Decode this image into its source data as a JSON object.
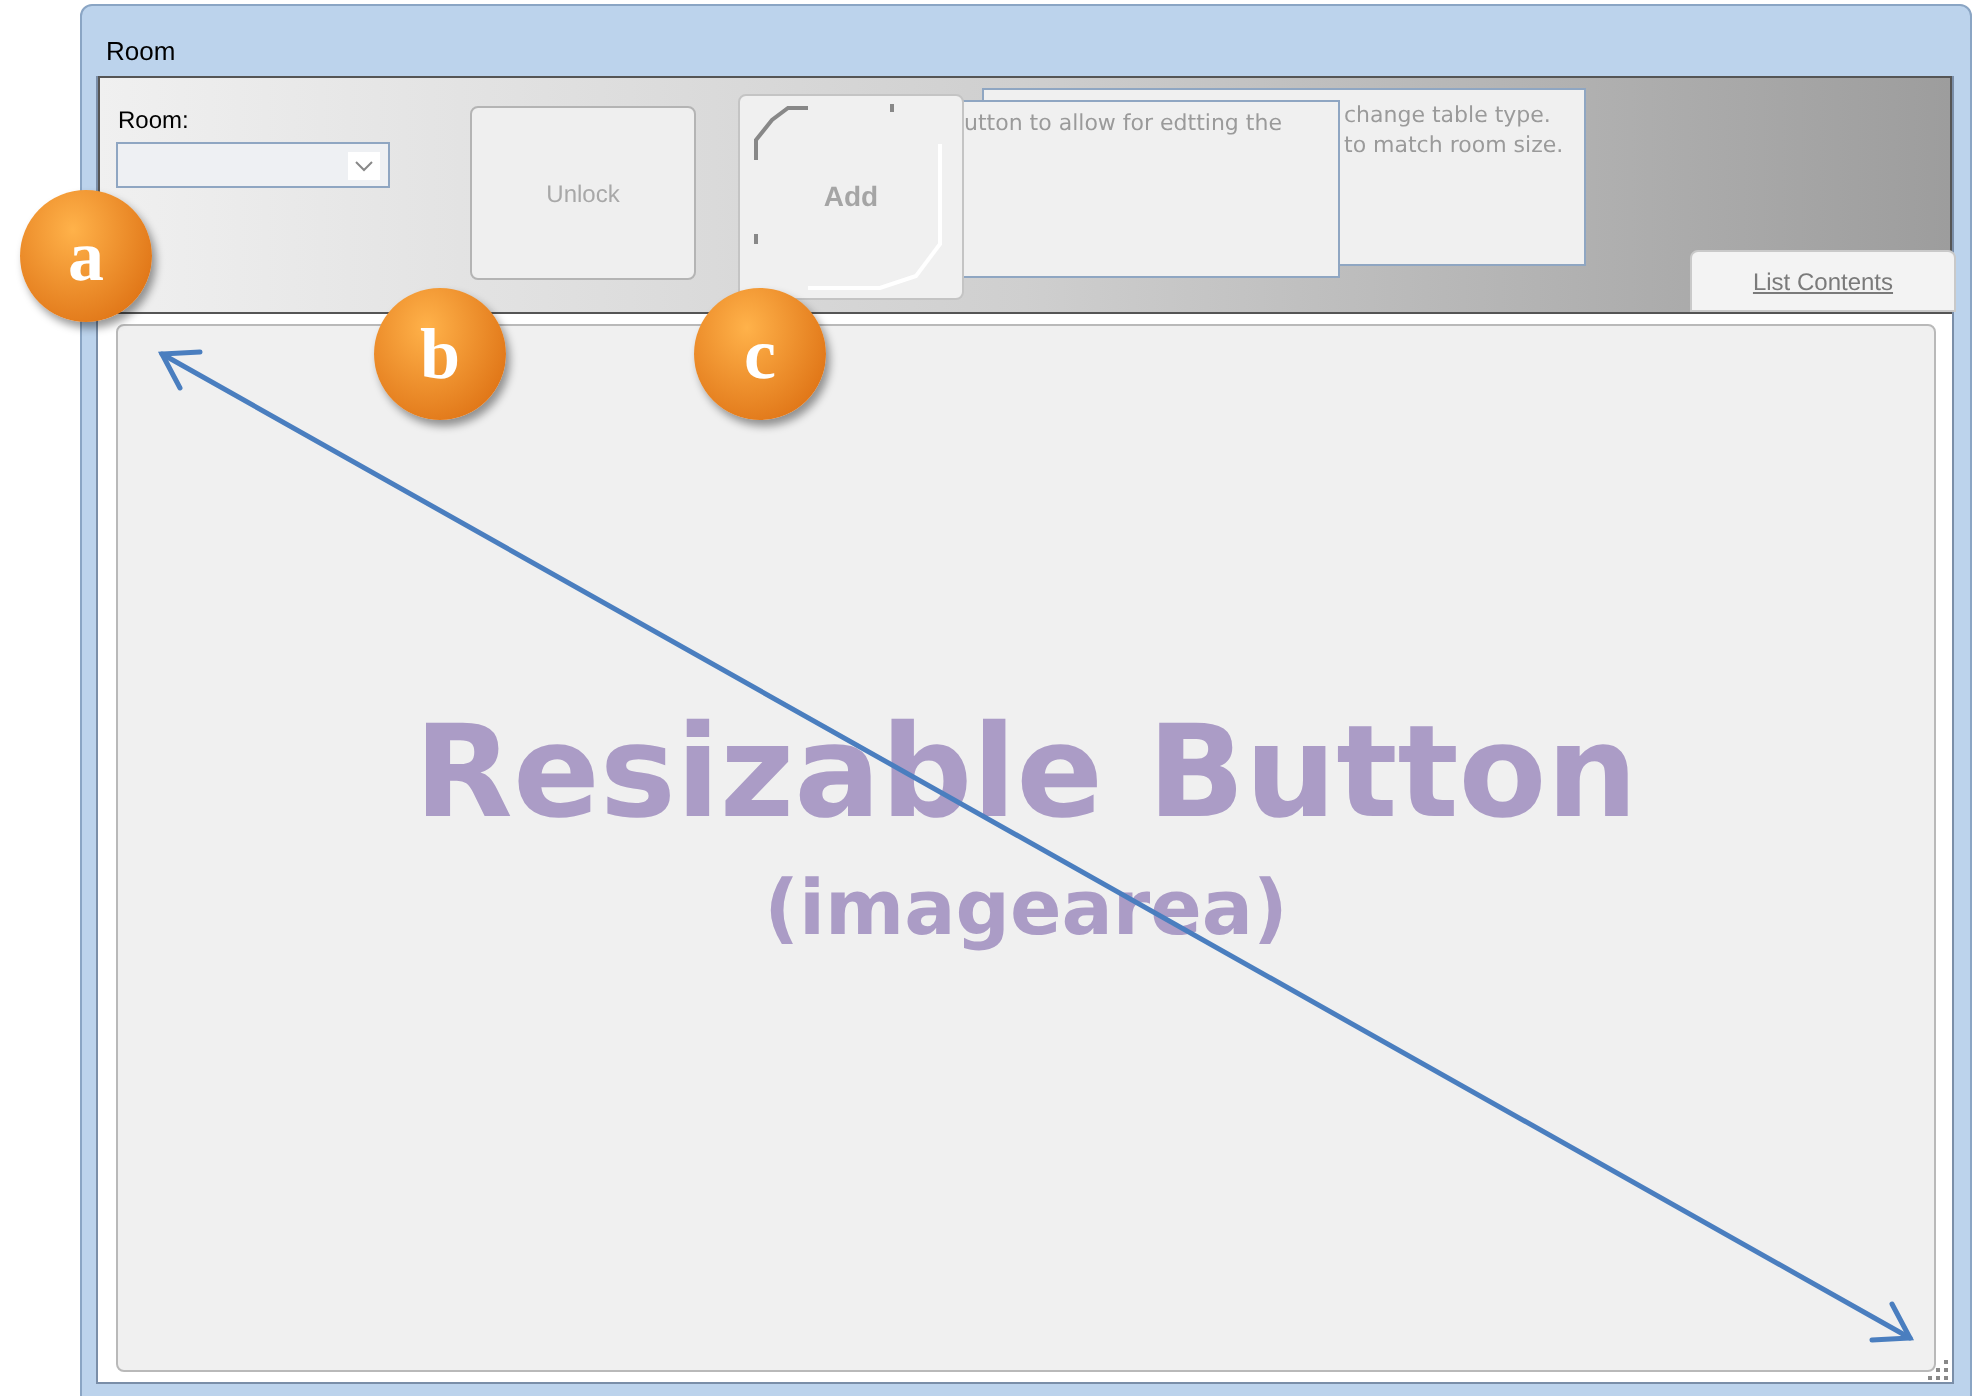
{
  "window": {
    "title": "Room"
  },
  "toolbar": {
    "room_label": "Room:",
    "unlock_button": "Unlock",
    "add_button": "Add",
    "note_front": "utton to allow for edtting the",
    "note_back_lines": [
      "change table type.",
      "to match room size."
    ],
    "list_contents_tab": "List Contents"
  },
  "image_area": {
    "title": "Resizable Button",
    "subtitle": "(imagearea)"
  },
  "callouts": [
    "a",
    "b",
    "c"
  ]
}
